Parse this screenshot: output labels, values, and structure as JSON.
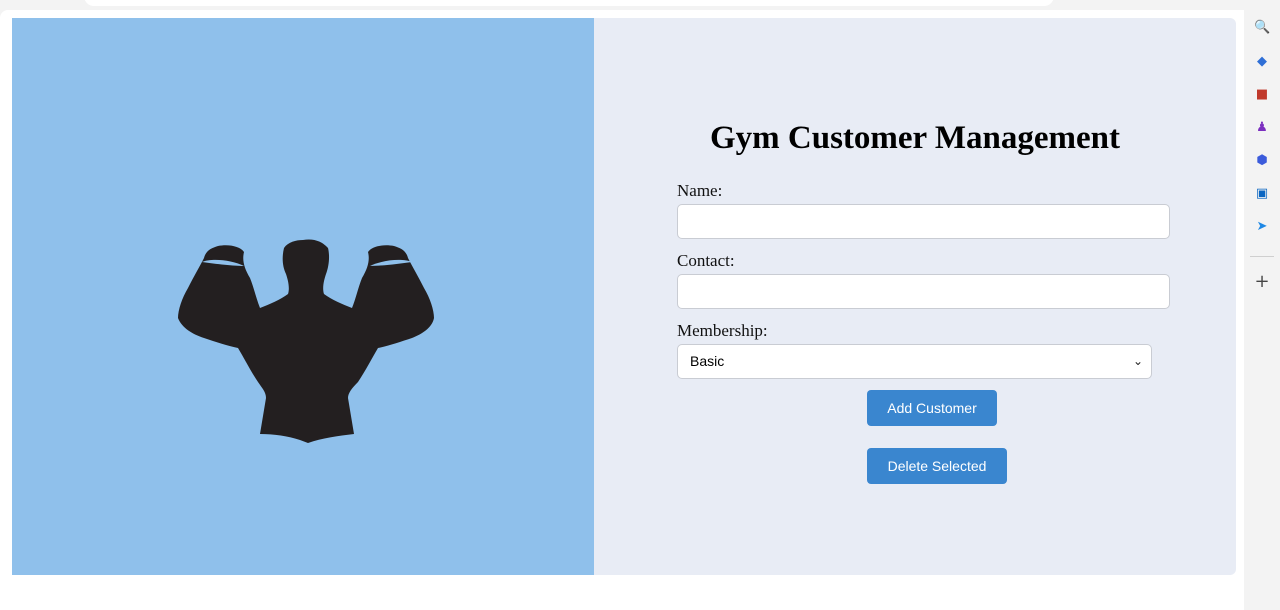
{
  "app": {
    "title": "Gym Customer Management"
  },
  "form": {
    "name_label": "Name:",
    "name_value": "",
    "contact_label": "Contact:",
    "contact_value": "",
    "membership_label": "Membership:",
    "membership_selected": "Basic",
    "add_button": "Add Customer",
    "delete_button": "Delete Selected"
  },
  "hero": {
    "icon": "bodybuilder-silhouette-icon"
  },
  "browser_sidebar": {
    "icons": [
      "search-icon",
      "tag-icon",
      "briefcase-icon",
      "games-icon",
      "copilot-icon",
      "outlook-icon",
      "send-icon",
      "add-icon"
    ]
  },
  "colors": {
    "left_panel": "#8fc0eb",
    "right_panel": "#e8ecf5",
    "button": "#3a86cf"
  }
}
